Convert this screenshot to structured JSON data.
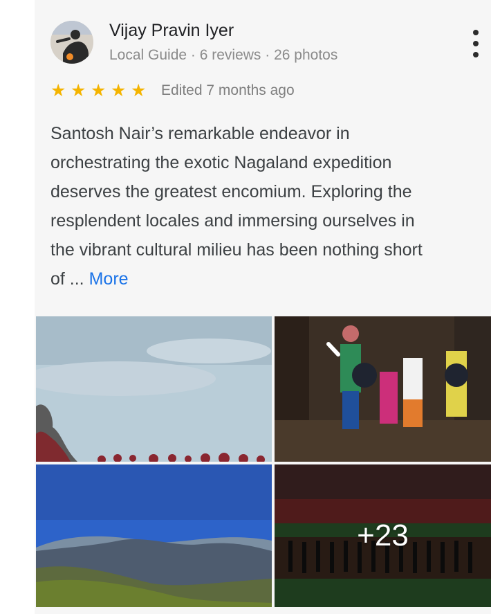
{
  "review": {
    "author": "Vijay Pravin Iyer",
    "author_meta": "Local Guide · 6 reviews · 26 photos",
    "rating": 5,
    "edited": "Edited 7 months ago",
    "text_lines": [
      "Santosh Nair’s remarkable endeavor in",
      "orchestrating the exotic Nagaland expedition",
      "deserves the greatest encomium. Exploring the",
      "resplendent locales and immersing ourselves in",
      "the vibrant cultural milieu has been nothing short",
      "of ..."
    ],
    "more_label": "More"
  },
  "photos": {
    "more_count": "+23"
  },
  "colors": {
    "star": "#f4b400",
    "link": "#1a73e8",
    "text": "#3c4043",
    "meta": "#8a8a8a"
  },
  "icons": {
    "menu": "more-vert-icon",
    "star": "star-icon"
  }
}
